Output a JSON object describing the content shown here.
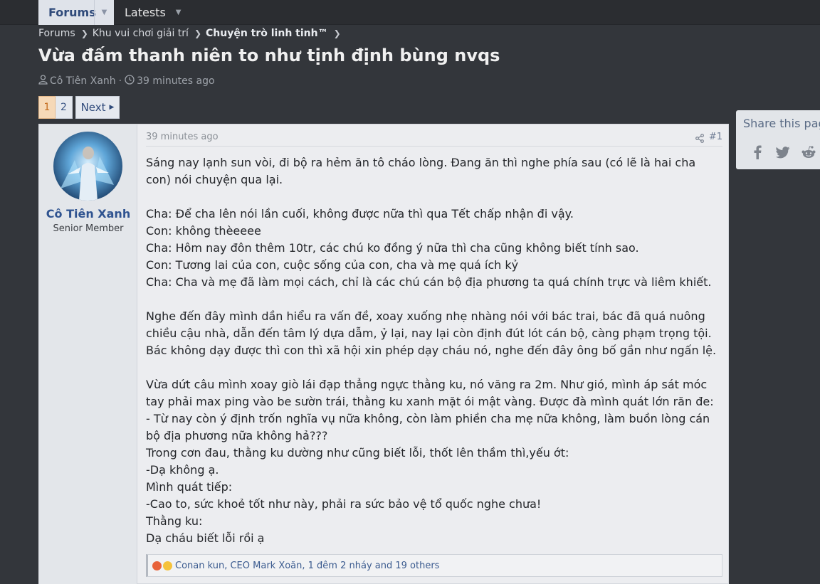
{
  "nav": {
    "forums_label": "Forums",
    "latests_label": "Latests"
  },
  "breadcrumb": {
    "items": [
      "Forums",
      "Khu vui chơi giải trí",
      "Chuyện trò linh tinh™"
    ]
  },
  "thread": {
    "title": "Vừa đấm thanh niên to như tịnh định bùng nvqs",
    "author": "Cô Tiên Xanh",
    "time": "39 minutes ago"
  },
  "pagination": {
    "pages": [
      "1",
      "2"
    ],
    "next_label": "Next"
  },
  "post": {
    "username": "Cô Tiên Xanh",
    "user_title": "Senior Member",
    "time": "39 minutes ago",
    "number": "#1",
    "lines": [
      "Sáng nay lạnh sun vòi, đi bộ ra hẻm ăn tô cháo lòng. Đang ăn thì nghe phía sau (có lẽ là hai cha con) nói chuyện qua lại.",
      "",
      "Cha: Để cha lên nói lần cuối, không được nữa thì qua Tết chấp nhận đi vậy.",
      "Con: không thèeeee",
      "Cha: Hôm nay đôn thêm 10tr, các chú ko đồng ý nữa thì cha cũng không biết tính sao.",
      "Con: Tương lai của con, cuộc sống của con, cha và mẹ quá ích kỷ",
      "Cha: Cha và mẹ đã làm mọi cách, chỉ là các chú cán bộ địa phương ta quá chính trực và liêm khiết.",
      "",
      "Nghe đến đây mình dần hiểu ra vấn đề, xoay xuống nhẹ nhàng nói với bác trai, bác đã quá nuông chiều cậu nhà, dẫn đến tâm lý dựa dẫm, ỷ lại, nay lại còn định đút lót cán bộ, càng phạm trọng tội. Bác không dạy được thì con thì xã hội xin phép dạy cháu nó, nghe đến đây ông bố gần như ngấn lệ.",
      "",
      "Vừa dứt câu mình xoay giò lái đạp thẳng ngực thằng ku, nó văng ra 2m. Như gió, mình áp sát móc tay phải max ping vào be sườn trái, thằng ku xanh mặt ói mật vàng. Được đà mình quát lớn răn đe:",
      "- Từ nay còn ý định trốn nghĩa vụ nữa không, còn làm phiền cha mẹ nữa không, làm buồn lòng cán bộ địa phương nữa không hả???",
      "Trong cơn đau, thằng ku dường như cũng biết lỗi, thốt lên thầm thì,yếu ớt:",
      "-Dạ không ạ.",
      "Mình quát tiếp:",
      "-Cao to, sức khoẻ tốt như này, phải ra sức bảo vệ tổ quốc nghe chưa!",
      "Thằng ku:",
      "Dạ cháu biết lỗi rồi ạ"
    ],
    "reactions": "Conan kun, CEO Mark Xoăn, 1 đêm 2 nháy and 19 others"
  },
  "share": {
    "title": "Share this page",
    "icons": [
      "facebook-icon",
      "twitter-icon",
      "reddit-icon"
    ]
  },
  "colors": {
    "background": "#33363b",
    "accent": "#2f5390",
    "active_page": "#f6d9b8"
  }
}
